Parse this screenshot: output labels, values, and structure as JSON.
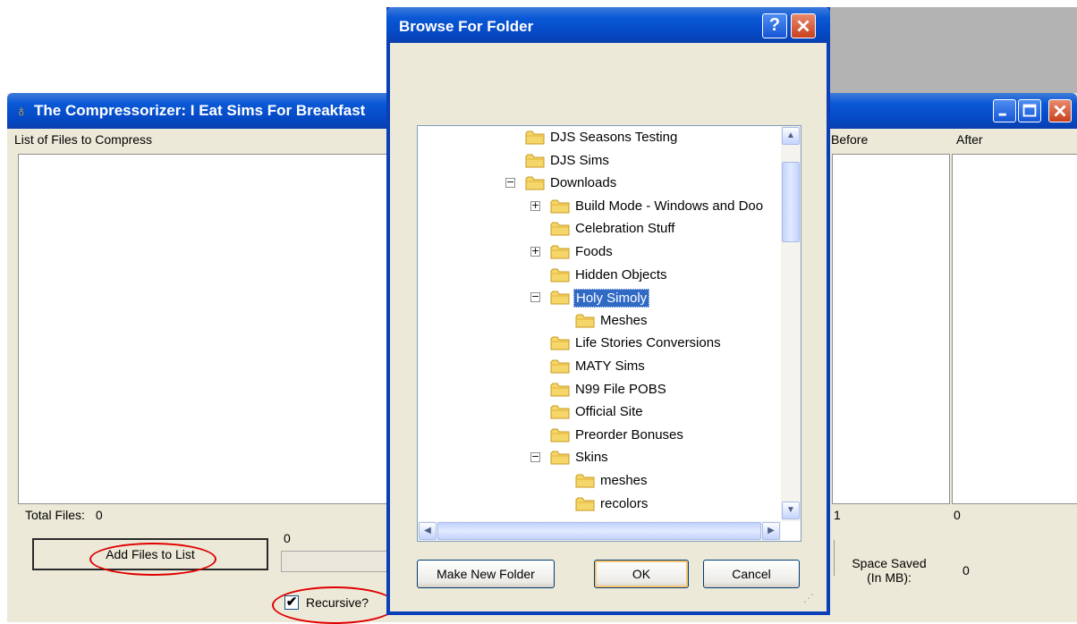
{
  "main_window": {
    "title": "The Compressorizer: I Eat Sims For Breakfast",
    "list_label": "List of Files to Compress",
    "before_header": "Before",
    "after_header": "After",
    "total_files_label": "Total Files:",
    "total_files_value": "0",
    "before_total": "1",
    "after_total": "0",
    "add_files_button": "Add Files to List",
    "progress_value": "0",
    "recursive_label": "Recursive?",
    "recursive_checked": "✔",
    "space_saved_label": "Space Saved (In MB):",
    "space_saved_value": "0"
  },
  "dialog": {
    "title": "Browse For Folder",
    "help_glyph": "?",
    "tree": [
      {
        "label": "DJS Seasons Testing"
      },
      {
        "label": "DJS Sims"
      },
      {
        "label": "Downloads",
        "expander": "−"
      },
      {
        "label": "Build Mode - Windows and Doo",
        "expander": "+"
      },
      {
        "label": "Celebration Stuff"
      },
      {
        "label": "Foods",
        "expander": "+"
      },
      {
        "label": "Hidden Objects"
      },
      {
        "label": "Holy Simoly",
        "expander": "−",
        "selected": true
      },
      {
        "label": "Meshes"
      },
      {
        "label": "Life Stories Conversions"
      },
      {
        "label": "MATY Sims"
      },
      {
        "label": "N99 File POBS"
      },
      {
        "label": "Official Site"
      },
      {
        "label": "Preorder Bonuses"
      },
      {
        "label": "Skins",
        "expander": "−"
      },
      {
        "label": "meshes"
      },
      {
        "label": "recolors"
      }
    ],
    "make_new_folder_button": "Make New Folder",
    "ok_button": "OK",
    "cancel_button": "Cancel"
  },
  "colors": {
    "title_bar_blue": "#0548c4",
    "selection_blue": "#316ac5",
    "annotation_red": "#e00000",
    "folder_yellow": "#f5d66a"
  }
}
